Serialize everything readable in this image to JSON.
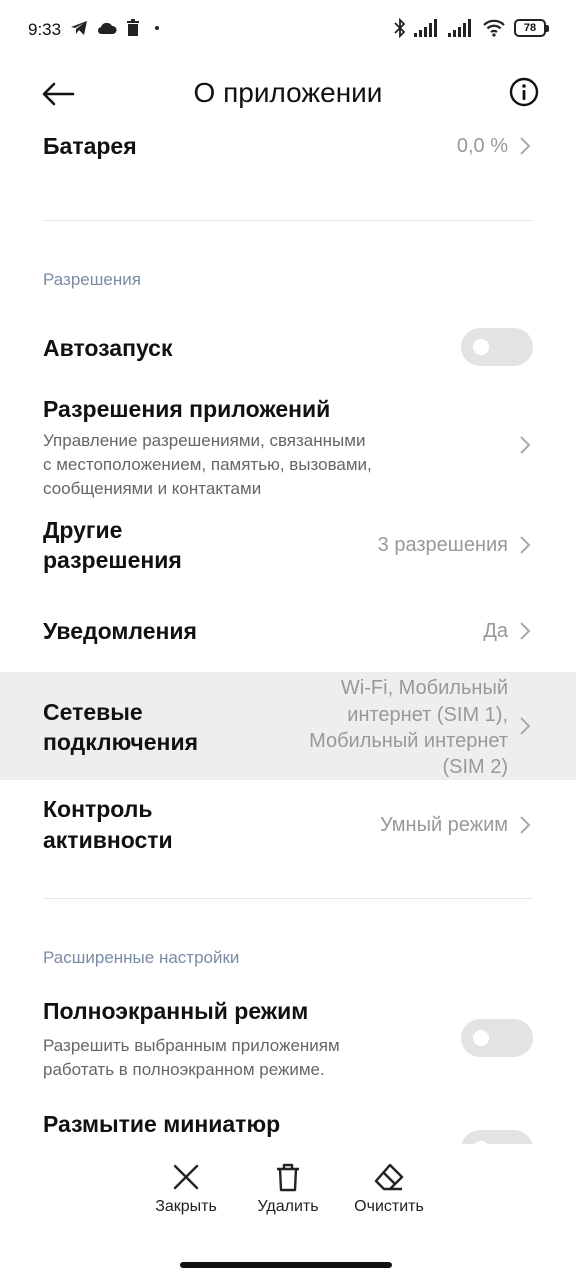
{
  "status_bar": {
    "time": "9:33",
    "battery": "78",
    "left_icons": [
      "telegram-icon",
      "cloud-icon",
      "trash-icon",
      "dot-icon"
    ],
    "right_icons": [
      "bluetooth-icon",
      "signal-icon",
      "signal-icon",
      "wifi-icon",
      "battery-icon"
    ]
  },
  "header": {
    "title": "О приложении",
    "back_icon": "arrow-left-icon",
    "info_icon": "info-icon"
  },
  "battery_row": {
    "title": "Батарея",
    "value": "0,0 %"
  },
  "permissions": {
    "section_title": "Разрешения",
    "autostart": {
      "title": "Автозапуск",
      "enabled": false
    },
    "app_permissions": {
      "title": "Разрешения приложений",
      "desc_lines": [
        "Управление разрешениями, связанными",
        "с местоположением, памятью, вызовами,",
        "сообщениями и контактами"
      ]
    },
    "other_permissions": {
      "title_lines": [
        "Другие",
        "разрешения"
      ],
      "value": "3 разрешения"
    },
    "notifications": {
      "title": "Уведомления",
      "value": "Да"
    },
    "network": {
      "title_lines": [
        "Сетевые",
        "подключения"
      ],
      "value_lines": [
        "Wi-Fi, Мобильный",
        "интернет (SIM 1),",
        "Мобильный интернет",
        "(SIM 2)"
      ]
    },
    "activity_control": {
      "title_lines": [
        "Контроль",
        "активности"
      ],
      "value": "Умный режим"
    }
  },
  "advanced": {
    "section_title": "Расширенные настройки",
    "fullscreen": {
      "title": "Полноэкранный режим",
      "desc_lines": [
        "Разрешить выбранным приложениям",
        "работать в полноэкранном режиме."
      ],
      "enabled": false
    },
    "blur_thumbnails": {
      "title": "Размытие миниатюр",
      "enabled": false
    }
  },
  "bottom_actions": {
    "close": "Закрыть",
    "delete": "Удалить",
    "clear": "Очистить"
  },
  "colors": {
    "section_title": "#7a8ca6",
    "secondary_text": "#999999",
    "toggle_off": "#e3e3e3",
    "highlight_row": "#eeeeee"
  }
}
